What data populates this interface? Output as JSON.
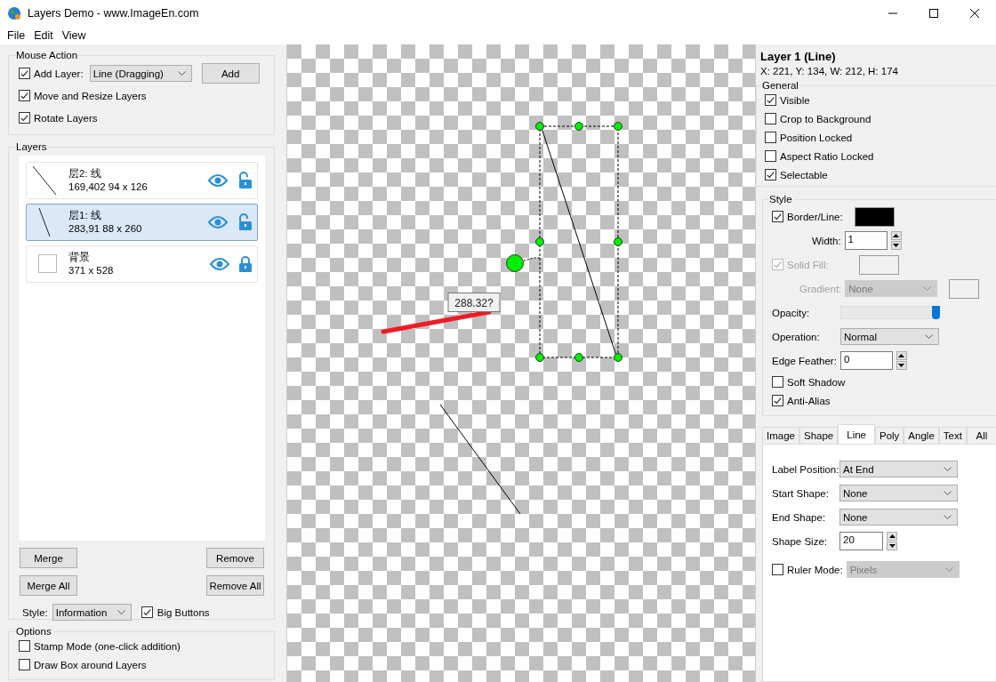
{
  "window": {
    "title": "Layers Demo  - www.ImageEn.com"
  },
  "menu": [
    "File",
    "Edit",
    "View"
  ],
  "mouse_action": {
    "title": "Mouse Action",
    "add_layer": {
      "label": "Add Layer:",
      "checked": true,
      "value": "Line (Dragging)",
      "button": "Add"
    },
    "options": [
      {
        "label": "Move and Resize Layers",
        "checked": true
      },
      {
        "label": "Rotate Layers",
        "checked": true
      }
    ]
  },
  "layers": {
    "title": "Layers",
    "items": [
      {
        "name": "层2: 线",
        "info": "169,402  94 x 126",
        "selected": false,
        "locked": false,
        "kind": "line"
      },
      {
        "name": "层1: 线",
        "info": "283,91  88 x 260",
        "selected": true,
        "locked": false,
        "kind": "line"
      },
      {
        "name": "背景",
        "info": "371 x 528",
        "selected": false,
        "locked": true,
        "kind": "image"
      }
    ],
    "buttons": [
      "Merge",
      "Remove",
      "Merge All",
      "Remove All"
    ],
    "style": {
      "label": "Style:",
      "value": "Information"
    },
    "big_buttons": {
      "label": "Big Buttons",
      "checked": true
    }
  },
  "options": {
    "title": "Options",
    "items": [
      {
        "label": "Stamp Mode (one-click addition)",
        "checked": false
      },
      {
        "label": "Draw Box around Layers",
        "checked": false
      }
    ]
  },
  "canvas": {
    "measurement": "288.32?"
  },
  "properties": {
    "title": "Layer 1 (Line)",
    "info": "X: 221, Y: 134, W: 212, H: 174",
    "general": {
      "title": "General",
      "items": [
        {
          "label": "Visible",
          "checked": true
        },
        {
          "label": "Crop to Background",
          "checked": false
        },
        {
          "label": "Position Locked",
          "checked": false
        },
        {
          "label": "Aspect Ratio Locked",
          "checked": false
        },
        {
          "label": "Selectable",
          "checked": true
        }
      ]
    },
    "style": {
      "title": "Style",
      "border_line": {
        "label": "Border/Line:",
        "checked": true,
        "color": "#000000"
      },
      "width": {
        "label": "Width:",
        "value": "1"
      },
      "solid_fill": {
        "label": "Solid Fill:",
        "checked": true,
        "disabled": true
      },
      "gradient": {
        "label": "Gradient:",
        "value": "None",
        "disabled": true
      },
      "opacity": {
        "label": "Opacity:",
        "level": 1
      },
      "operation": {
        "label": "Operation:",
        "value": "Normal"
      },
      "edge_feather": {
        "label": "Edge Feather:",
        "value": "0"
      },
      "checks": [
        {
          "label": "Soft Shadow",
          "checked": false
        },
        {
          "label": "Anti-Alias",
          "checked": true
        }
      ]
    },
    "tabs": [
      {
        "label": "Image",
        "selected": false
      },
      {
        "label": "Shape",
        "selected": false
      },
      {
        "label": "Line",
        "selected": true
      },
      {
        "label": "Poly",
        "selected": false
      },
      {
        "label": "Angle",
        "selected": false
      },
      {
        "label": "Text",
        "selected": false
      },
      {
        "label": "All",
        "selected": false
      }
    ],
    "line_tab": {
      "fields": [
        {
          "label": "Label Position:",
          "value": "At End"
        },
        {
          "label": "Start Shape:",
          "value": "None"
        },
        {
          "label": "End Shape:",
          "value": "None"
        }
      ],
      "shape_size": {
        "label": "Shape Size:",
        "value": "20"
      },
      "ruler_mode": {
        "label": "Ruler Mode:",
        "checked": false,
        "value": "Pixels",
        "disabled": true
      }
    }
  }
}
